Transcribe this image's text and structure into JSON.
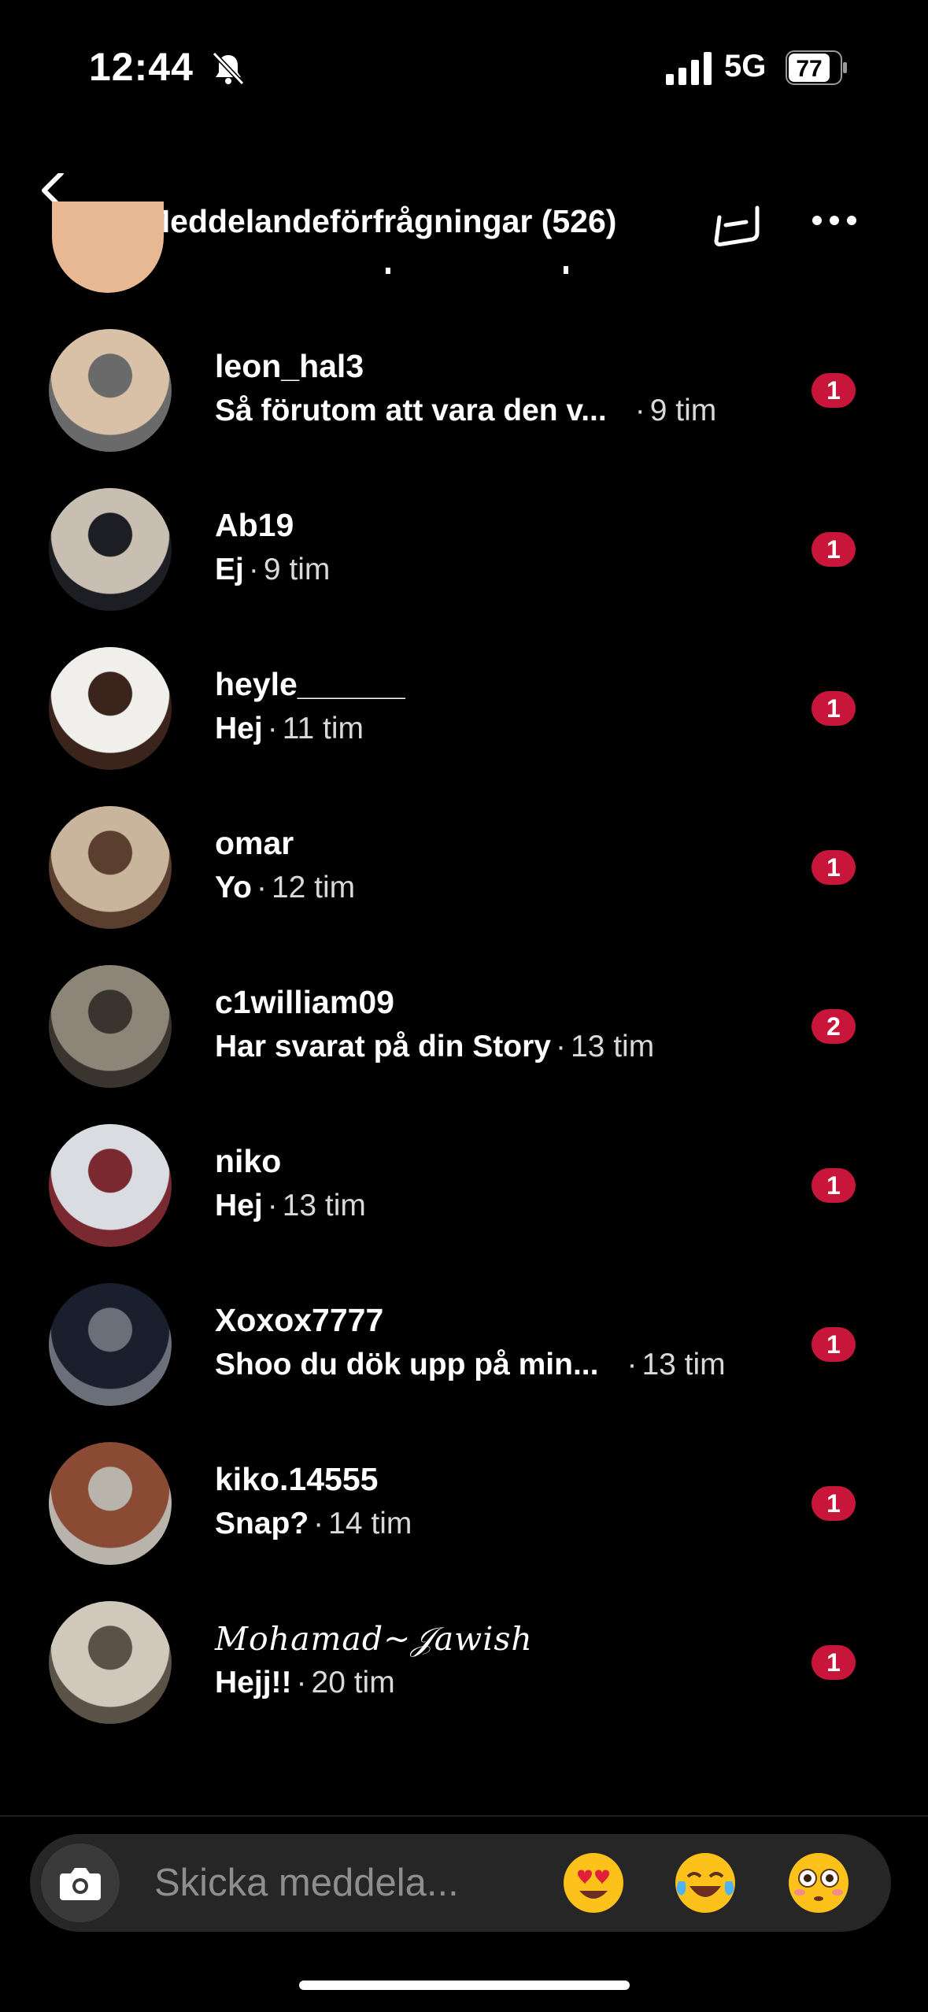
{
  "status": {
    "time": "12:44",
    "network": "5G",
    "battery": "77"
  },
  "header": {
    "title": "Meddelandeförfrågningar (526)"
  },
  "requests": [
    {
      "name": "leon_hal3",
      "message": "Så förutom att vara den v...",
      "time": "9 tim",
      "unread": "1",
      "photo_colors": [
        "#d9c1a8",
        "#6a6a6a"
      ]
    },
    {
      "name": "Ab19",
      "message": "Ej",
      "time": "9 tim",
      "unread": "1",
      "photo_colors": [
        "#c8bfb2",
        "#1d1d24"
      ]
    },
    {
      "name": "heyle______",
      "message": "Hej",
      "time": "11 tim",
      "unread": "1",
      "photo_colors": [
        "#f0efec",
        "#3b241c"
      ]
    },
    {
      "name": "omar",
      "message": "Yo",
      "time": "12 tim",
      "unread": "1",
      "photo_colors": [
        "#c9b59c",
        "#5a3e2e"
      ]
    },
    {
      "name": "c1william09",
      "message": "Har svarat på din Story",
      "time": "13 tim",
      "unread": "2",
      "photo_colors": [
        "#8d8577",
        "#3a342e"
      ]
    },
    {
      "name": "niko",
      "message": "Hej",
      "time": "13 tim",
      "unread": "1",
      "photo_colors": [
        "#d9dde2",
        "#7a2930"
      ]
    },
    {
      "name": "Xoxox7777",
      "message": "Shoo du dök upp på min...",
      "time": "13 tim",
      "unread": "1",
      "photo_colors": [
        "#1a1f2e",
        "#6b6f7a"
      ]
    },
    {
      "name": "kiko.14555",
      "message": "Snap?",
      "time": "14 tim",
      "unread": "1",
      "photo_colors": [
        "#8a4a34",
        "#b9b4ab"
      ]
    },
    {
      "name": "𝑀𝑜ℎ𝑎𝑚𝑎𝑑~𝒥𝑎𝑤𝑖𝑠ℎ",
      "message": "Hejj!!",
      "time": "20 tim",
      "unread": "1",
      "photo_colors": [
        "#cfc8bb",
        "#5b5247"
      ]
    }
  ],
  "composer": {
    "placeholder": "Skicka meddela..."
  },
  "quick_emojis": [
    "heart-eyes",
    "tears-of-joy",
    "flushed"
  ],
  "colors": {
    "badge": "#c8163a",
    "background": "#000000"
  }
}
